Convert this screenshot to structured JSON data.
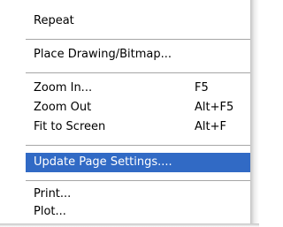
{
  "menu": {
    "items": [
      {
        "label": "Repeat",
        "shortcut": ""
      },
      {
        "label": "Place Drawing/Bitmap...",
        "shortcut": ""
      },
      {
        "label": "Zoom In...",
        "shortcut": "F5"
      },
      {
        "label": "Zoom Out",
        "shortcut": "Alt+F5"
      },
      {
        "label": "Fit to Screen",
        "shortcut": "Alt+F"
      },
      {
        "label": "Update Page Settings....",
        "shortcut": "",
        "highlighted": true
      },
      {
        "label": "Print...",
        "shortcut": ""
      },
      {
        "label": "Plot...",
        "shortcut": ""
      }
    ]
  },
  "colors": {
    "highlight": "#316ac5",
    "separator": "#a6a6a6"
  }
}
